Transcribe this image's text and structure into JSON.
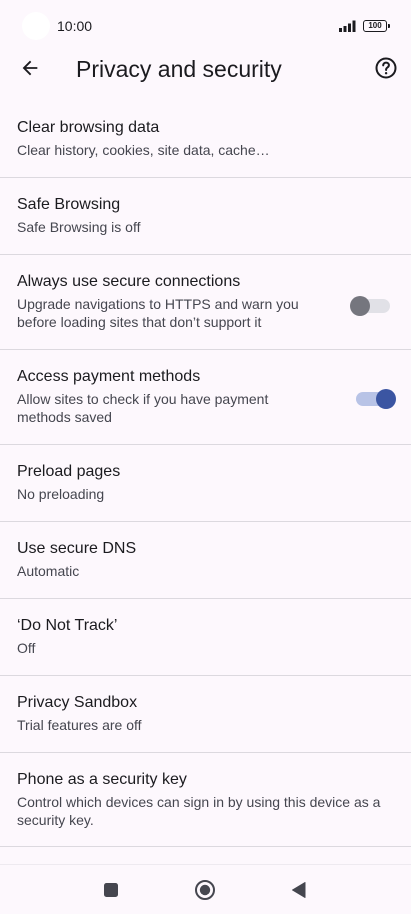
{
  "status": {
    "time": "10:00",
    "battery": "100"
  },
  "header": {
    "title": "Privacy and security",
    "back_icon": "arrow-back-icon",
    "help_icon": "help-circle-icon"
  },
  "items": [
    {
      "title": "Clear browsing data",
      "subtitle": "Clear history, cookies, site data, cache…"
    },
    {
      "title": "Safe Browsing",
      "subtitle": "Safe Browsing is off"
    },
    {
      "title": "Always use secure connections",
      "subtitle": "Upgrade navigations to HTTPS and warn you before loading sites that don’t support it",
      "toggle": false
    },
    {
      "title": "Access payment methods",
      "subtitle": "Allow sites to check if you have payment methods saved",
      "toggle": true
    },
    {
      "title": "Preload pages",
      "subtitle": "No preloading"
    },
    {
      "title": "Use secure DNS",
      "subtitle": "Automatic"
    },
    {
      "title": "‘Do Not Track’",
      "subtitle": "Off"
    },
    {
      "title": "Privacy Sandbox",
      "subtitle": "Trial features are off"
    },
    {
      "title": "Phone as a security key",
      "subtitle": "Control which devices can sign in by using this device as a security key."
    }
  ],
  "colors": {
    "background": "#fdf8fd",
    "toggle_on": "#3b55a2",
    "toggle_off": "#75767e"
  },
  "nav": {
    "recents_icon": "square-recents-icon",
    "home_icon": "circle-home-icon",
    "back_icon": "triangle-back-icon"
  }
}
